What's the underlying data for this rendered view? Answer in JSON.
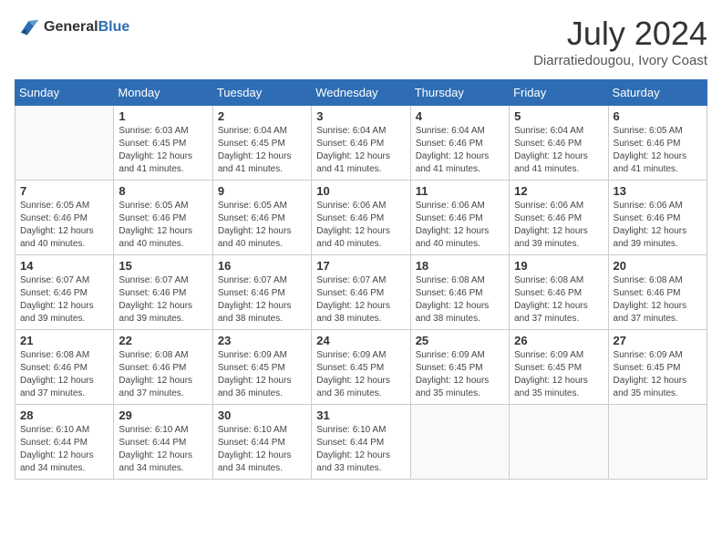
{
  "logo": {
    "line1": "General",
    "line2": "Blue"
  },
  "title": {
    "month_year": "July 2024",
    "location": "Diarratiedougou, Ivory Coast"
  },
  "weekdays": [
    "Sunday",
    "Monday",
    "Tuesday",
    "Wednesday",
    "Thursday",
    "Friday",
    "Saturday"
  ],
  "weeks": [
    [
      {
        "day": "",
        "sunrise": "",
        "sunset": "",
        "daylight": ""
      },
      {
        "day": "1",
        "sunrise": "Sunrise: 6:03 AM",
        "sunset": "Sunset: 6:45 PM",
        "daylight": "Daylight: 12 hours and 41 minutes."
      },
      {
        "day": "2",
        "sunrise": "Sunrise: 6:04 AM",
        "sunset": "Sunset: 6:45 PM",
        "daylight": "Daylight: 12 hours and 41 minutes."
      },
      {
        "day": "3",
        "sunrise": "Sunrise: 6:04 AM",
        "sunset": "Sunset: 6:46 PM",
        "daylight": "Daylight: 12 hours and 41 minutes."
      },
      {
        "day": "4",
        "sunrise": "Sunrise: 6:04 AM",
        "sunset": "Sunset: 6:46 PM",
        "daylight": "Daylight: 12 hours and 41 minutes."
      },
      {
        "day": "5",
        "sunrise": "Sunrise: 6:04 AM",
        "sunset": "Sunset: 6:46 PM",
        "daylight": "Daylight: 12 hours and 41 minutes."
      },
      {
        "day": "6",
        "sunrise": "Sunrise: 6:05 AM",
        "sunset": "Sunset: 6:46 PM",
        "daylight": "Daylight: 12 hours and 41 minutes."
      }
    ],
    [
      {
        "day": "7",
        "sunrise": "Sunrise: 6:05 AM",
        "sunset": "Sunset: 6:46 PM",
        "daylight": "Daylight: 12 hours and 40 minutes."
      },
      {
        "day": "8",
        "sunrise": "Sunrise: 6:05 AM",
        "sunset": "Sunset: 6:46 PM",
        "daylight": "Daylight: 12 hours and 40 minutes."
      },
      {
        "day": "9",
        "sunrise": "Sunrise: 6:05 AM",
        "sunset": "Sunset: 6:46 PM",
        "daylight": "Daylight: 12 hours and 40 minutes."
      },
      {
        "day": "10",
        "sunrise": "Sunrise: 6:06 AM",
        "sunset": "Sunset: 6:46 PM",
        "daylight": "Daylight: 12 hours and 40 minutes."
      },
      {
        "day": "11",
        "sunrise": "Sunrise: 6:06 AM",
        "sunset": "Sunset: 6:46 PM",
        "daylight": "Daylight: 12 hours and 40 minutes."
      },
      {
        "day": "12",
        "sunrise": "Sunrise: 6:06 AM",
        "sunset": "Sunset: 6:46 PM",
        "daylight": "Daylight: 12 hours and 39 minutes."
      },
      {
        "day": "13",
        "sunrise": "Sunrise: 6:06 AM",
        "sunset": "Sunset: 6:46 PM",
        "daylight": "Daylight: 12 hours and 39 minutes."
      }
    ],
    [
      {
        "day": "14",
        "sunrise": "Sunrise: 6:07 AM",
        "sunset": "Sunset: 6:46 PM",
        "daylight": "Daylight: 12 hours and 39 minutes."
      },
      {
        "day": "15",
        "sunrise": "Sunrise: 6:07 AM",
        "sunset": "Sunset: 6:46 PM",
        "daylight": "Daylight: 12 hours and 39 minutes."
      },
      {
        "day": "16",
        "sunrise": "Sunrise: 6:07 AM",
        "sunset": "Sunset: 6:46 PM",
        "daylight": "Daylight: 12 hours and 38 minutes."
      },
      {
        "day": "17",
        "sunrise": "Sunrise: 6:07 AM",
        "sunset": "Sunset: 6:46 PM",
        "daylight": "Daylight: 12 hours and 38 minutes."
      },
      {
        "day": "18",
        "sunrise": "Sunrise: 6:08 AM",
        "sunset": "Sunset: 6:46 PM",
        "daylight": "Daylight: 12 hours and 38 minutes."
      },
      {
        "day": "19",
        "sunrise": "Sunrise: 6:08 AM",
        "sunset": "Sunset: 6:46 PM",
        "daylight": "Daylight: 12 hours and 37 minutes."
      },
      {
        "day": "20",
        "sunrise": "Sunrise: 6:08 AM",
        "sunset": "Sunset: 6:46 PM",
        "daylight": "Daylight: 12 hours and 37 minutes."
      }
    ],
    [
      {
        "day": "21",
        "sunrise": "Sunrise: 6:08 AM",
        "sunset": "Sunset: 6:46 PM",
        "daylight": "Daylight: 12 hours and 37 minutes."
      },
      {
        "day": "22",
        "sunrise": "Sunrise: 6:08 AM",
        "sunset": "Sunset: 6:46 PM",
        "daylight": "Daylight: 12 hours and 37 minutes."
      },
      {
        "day": "23",
        "sunrise": "Sunrise: 6:09 AM",
        "sunset": "Sunset: 6:45 PM",
        "daylight": "Daylight: 12 hours and 36 minutes."
      },
      {
        "day": "24",
        "sunrise": "Sunrise: 6:09 AM",
        "sunset": "Sunset: 6:45 PM",
        "daylight": "Daylight: 12 hours and 36 minutes."
      },
      {
        "day": "25",
        "sunrise": "Sunrise: 6:09 AM",
        "sunset": "Sunset: 6:45 PM",
        "daylight": "Daylight: 12 hours and 35 minutes."
      },
      {
        "day": "26",
        "sunrise": "Sunrise: 6:09 AM",
        "sunset": "Sunset: 6:45 PM",
        "daylight": "Daylight: 12 hours and 35 minutes."
      },
      {
        "day": "27",
        "sunrise": "Sunrise: 6:09 AM",
        "sunset": "Sunset: 6:45 PM",
        "daylight": "Daylight: 12 hours and 35 minutes."
      }
    ],
    [
      {
        "day": "28",
        "sunrise": "Sunrise: 6:10 AM",
        "sunset": "Sunset: 6:44 PM",
        "daylight": "Daylight: 12 hours and 34 minutes."
      },
      {
        "day": "29",
        "sunrise": "Sunrise: 6:10 AM",
        "sunset": "Sunset: 6:44 PM",
        "daylight": "Daylight: 12 hours and 34 minutes."
      },
      {
        "day": "30",
        "sunrise": "Sunrise: 6:10 AM",
        "sunset": "Sunset: 6:44 PM",
        "daylight": "Daylight: 12 hours and 34 minutes."
      },
      {
        "day": "31",
        "sunrise": "Sunrise: 6:10 AM",
        "sunset": "Sunset: 6:44 PM",
        "daylight": "Daylight: 12 hours and 33 minutes."
      },
      {
        "day": "",
        "sunrise": "",
        "sunset": "",
        "daylight": ""
      },
      {
        "day": "",
        "sunrise": "",
        "sunset": "",
        "daylight": ""
      },
      {
        "day": "",
        "sunrise": "",
        "sunset": "",
        "daylight": ""
      }
    ]
  ]
}
